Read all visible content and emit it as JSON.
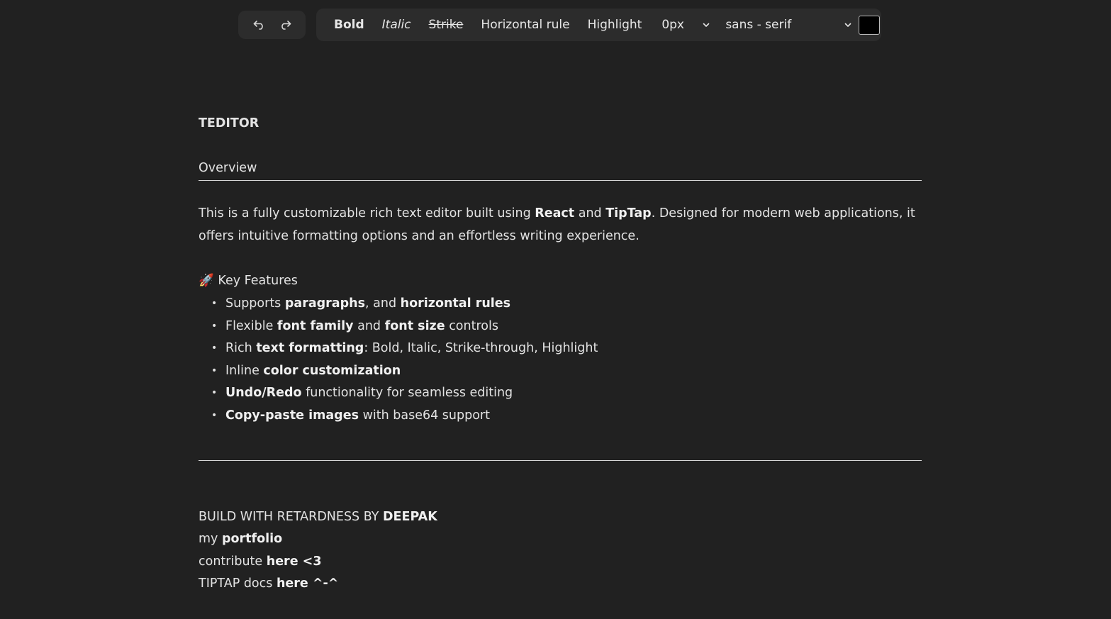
{
  "toolbar": {
    "undo_icon": "undo-icon",
    "redo_icon": "redo-icon",
    "bold_label": "Bold",
    "italic_label": "Italic",
    "strike_label": "Strike",
    "hr_label": "Horizontal rule",
    "highlight_label": "Highlight",
    "font_size_value": "0px",
    "font_family_value": "sans - serif",
    "text_color": "#000000"
  },
  "document": {
    "title": "TEDITOR",
    "overview_heading": "Overview",
    "intro": {
      "part1": "This is a fully customizable rich text editor built using ",
      "react": "React",
      "and": " and ",
      "tiptap": "TipTap",
      "part2": ". Designed for modern web applications, it offers intuitive formatting options and an effortless writing experience."
    },
    "features_emoji": "🚀",
    "features_heading": "Key Features",
    "features": [
      {
        "pre": "Supports ",
        "b1": "paragraphs",
        "mid": ", and ",
        "b2": "horizontal rules",
        "post": ""
      },
      {
        "pre": "Flexible ",
        "b1": "font family",
        "mid": " and ",
        "b2": "font size",
        "post": " controls"
      },
      {
        "pre": "Rich ",
        "b1": "text formatting",
        "mid": ": Bold, Italic, Strike-through, Highlight",
        "b2": "",
        "post": ""
      },
      {
        "pre": "Inline ",
        "b1": "color customization",
        "mid": "",
        "b2": "",
        "post": ""
      },
      {
        "pre": "",
        "b1": "Undo/Redo",
        "mid": " functionality for seamless editing",
        "b2": "",
        "post": ""
      },
      {
        "pre": "",
        "b1": "Copy-paste images",
        "mid": " with base64 support",
        "b2": "",
        "post": ""
      }
    ],
    "footer": {
      "credit_pre": "BUILD WITH RETARDNESS BY ",
      "credit_name": "DEEPAK",
      "portfolio_pre": "my ",
      "portfolio_link": "portfolio",
      "contribute_pre": "contribute ",
      "contribute_link": "here <3",
      "docs_pre": "TIPTAP docs ",
      "docs_link": "here ^-^"
    }
  }
}
